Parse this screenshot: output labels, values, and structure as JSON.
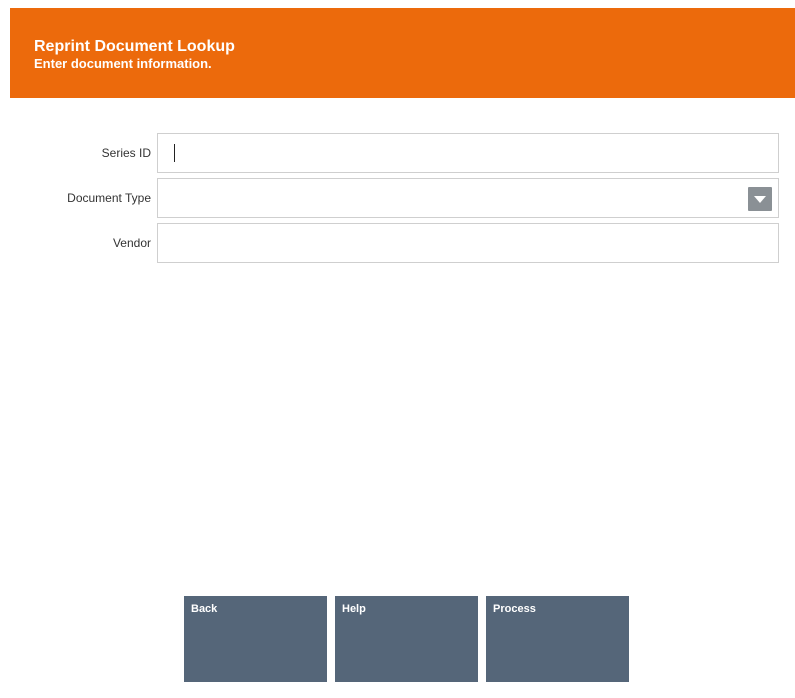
{
  "header": {
    "title": "Reprint Document Lookup",
    "subtitle": "Enter document information."
  },
  "form": {
    "series_id": {
      "label": "Series ID",
      "value": ""
    },
    "document_type": {
      "label": "Document Type",
      "value": ""
    },
    "vendor": {
      "label": "Vendor",
      "value": ""
    }
  },
  "buttons": {
    "back": "Back",
    "help": "Help",
    "process": "Process"
  },
  "colors": {
    "header_bg": "#ec6a0c",
    "button_bg": "#556679",
    "dropdown_bg": "#8a9095"
  },
  "icons": {
    "dropdown": "chevron-down-icon"
  }
}
